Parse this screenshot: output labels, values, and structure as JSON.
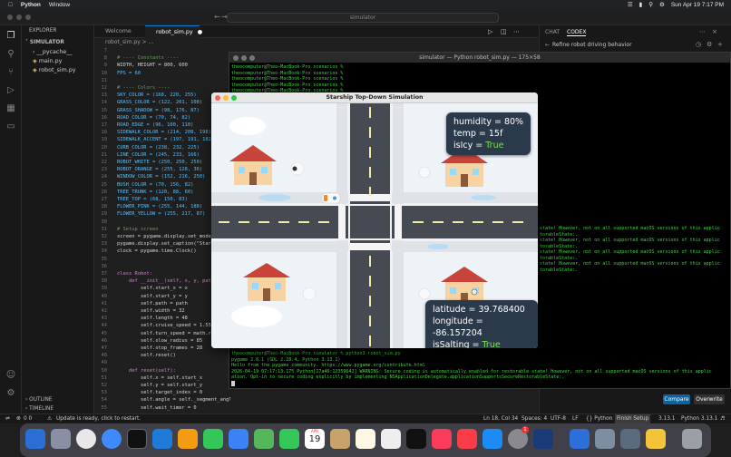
{
  "menubar": {
    "app": "Python",
    "menu_window": "Window",
    "clock": "Sun Apr 19  7:17 PM"
  },
  "editor": {
    "command_center": "simulator",
    "explorer_title": "EXPLORER",
    "project": "SIMULATOR",
    "files": [
      "__pycache__",
      "main.py",
      "robot_sim.py"
    ],
    "outline": "OUTLINE",
    "timeline": "TIMELINE",
    "tabs": [
      {
        "label": "Welcome"
      },
      {
        "label": "robot_sim.py"
      }
    ],
    "breadcrumb": "robot_sim.py  >  ...",
    "line_numbers": [
      "7",
      "8",
      "9",
      "10",
      "11",
      "12",
      "13",
      "14",
      "15",
      "16",
      "17",
      "18",
      "19",
      "20",
      "21",
      "22",
      "23",
      "24",
      "25",
      "26",
      "27",
      "28",
      "29",
      "30",
      "31",
      "32",
      "33",
      "34",
      "35",
      "36",
      "37",
      "38",
      "39",
      "40",
      "41",
      "42",
      "43",
      "44",
      "45",
      "46",
      "47",
      "48",
      "49",
      "50",
      "51",
      "52",
      "53",
      "54",
      "55"
    ],
    "code_lines": [
      "",
      "# ---- Constants ----",
      "WIDTH, HEIGHT = 800, 600",
      "FPS = 60",
      "",
      "# ---- Colors ----",
      "SKY_COLOR = (168, 220, 255)",
      "GRASS_COLOR = (122, 201, 108)",
      "GRASS_SHADOW = (98, 176, 87)",
      "ROAD_COLOR = (70, 74, 82)",
      "ROAD_EDGE = (96, 100, 110)",
      "SIDEWALK_COLOR = (214, 208, 198)",
      "SIDEWALK_ACCENT = (197, 191, 182)",
      "CURB_COLOR = (238, 232, 225)",
      "LINE_COLOR = (245, 233, 166)",
      "ROBOT_WHITE = (250, 250, 250)",
      "ROBOT_ORANGE = (255, 128, 36)",
      "WINDOW_COLOR = (152, 216, 250)",
      "BUSH_COLOR = (70, 156, 82)",
      "TREE_TRUNK = (120, 88, 60)",
      "TREE_TOP = (68, 150, 83)",
      "FLOWER_PINK = (255, 144, 188)",
      "FLOWER_YELLOW = (255, 217, 87)",
      "",
      "# Setup screen",
      "screen = pygame.display.set_mode",
      "pygame.display.set_caption(\"Star",
      "clock = pygame.time.Clock()",
      "",
      "",
      "class Robot:",
      "    def __init__(self, x, y, pat",
      "        self.start_x = x",
      "        self.start_y = y",
      "        self.path = path",
      "        self.width = 32",
      "        self.length = 48",
      "        self.cruise_speed = 1.55",
      "        self.turn_speed = math.r",
      "        self.slow_radius = 85",
      "        self.stop_frames = 28",
      "        self.reset()",
      "",
      "    def reset(self):",
      "        self.x = self.start_x",
      "        self.y = self.start_y",
      "        self.target_index = 0",
      "        self.angle = self._segment_angle(0)",
      "        self.wait_timer = 0"
    ],
    "status_left": "Update is ready, click to restart.",
    "status_right": [
      "Ln 18, Col 34",
      "Spaces: 4",
      "UTF-8",
      "LF",
      "{} Python",
      "Finish Setup",
      "3.13.1",
      "Python 3.13.1"
    ],
    "status_counts": "0  0"
  },
  "terminal": {
    "title": "simulator — Python robot_sim.py — 175×58",
    "prompt_lines": [
      "theocomputer@Theo-MacBook-Pro scenarios %",
      "theocomputer@Theo-MacBook-Pro scenarios %",
      "theocomputer@Theo-MacBook-Pro scenarios %",
      "theocomputer@Theo-MacBook-Pro scenarios %",
      "theocomputer@Theo-MacBook-Pro scenarios %",
      "theocomputer@Theo-MacBook-Pro scenarios %"
    ],
    "warn_lines": [
      "state! However, not on all supported macOS versions of this applic",
      "torableState:.",
      "state! However, not on all supported macOS versions of this applic",
      "torableState:.",
      "state! However, not on all supported macOS versions of this applic",
      "torableState:.",
      "state! However, not on all supported macOS versions of this applic",
      "torableState:."
    ],
    "bottom_lines": [
      "theocomputer@Theo-MacBook-Pro simulator % python3 robot_sim.py",
      "pygame 2.6.1 (SDL 2.28.4, Python 3.13.1)",
      "Hello from the pygame community. https://www.pygame.org/contribute.html",
      "2026-04-19 07:17:13.175 Python[17a46:12359642] WARNING: Secure coding is automatically enabled for restorable state! However, not on all supported macOS versions of this applic",
      "ation. Opt-in to secure coding explicitly by implementing NSApplicationDelegate.applicationSupportsSecureRestorableState:."
    ]
  },
  "chat": {
    "tab_chat": "CHAT",
    "tab_codex": "CODEX",
    "item": "Refine robot driving behavior",
    "compare": "Compare",
    "overwrite": "Overwrite"
  },
  "game": {
    "title": "Starship Top-Down Simulation",
    "weather": {
      "humidity_label": "humidity = ",
      "humidity": "80%",
      "temp_label": "temp = ",
      "temp": "15f",
      "icy_label": "isIcy = ",
      "icy": "True"
    },
    "location": {
      "lat_label": "latitude = ",
      "lat": "39.768400",
      "lon_label": "longitude = ",
      "lon": "-86.157204",
      "salt_label": "isSalting = ",
      "salt": "True"
    }
  },
  "dock": {
    "calendar_month": "APR",
    "calendar_day": "19",
    "badge": "1"
  },
  "colors": {
    "snow": "#eef3f7",
    "road": "#464a52",
    "house": "#f7d3a1",
    "roof": "#c8443a",
    "accent_blue": "#0e639c",
    "status_green": "#7fdc5a"
  }
}
